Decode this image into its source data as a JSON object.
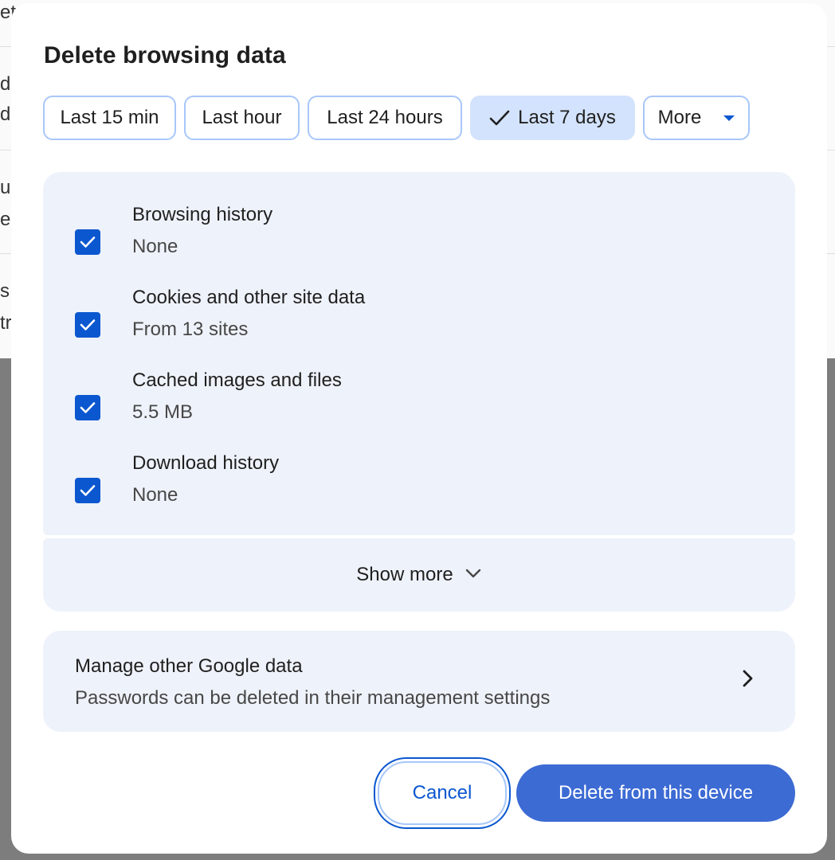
{
  "background": {
    "fragments": [
      "et",
      "d",
      "d",
      "u",
      "e",
      "s",
      "tr"
    ]
  },
  "dialog": {
    "title": "Delete browsing data",
    "time_ranges": [
      {
        "label": "Last 15 min",
        "selected": false
      },
      {
        "label": "Last hour",
        "selected": false
      },
      {
        "label": "Last 24 hours",
        "selected": false
      },
      {
        "label": "Last 7 days",
        "selected": true
      },
      {
        "label": "More",
        "selected": false,
        "dropdown": true
      }
    ],
    "items": [
      {
        "title": "Browsing history",
        "subtitle": "None",
        "checked": true
      },
      {
        "title": "Cookies and other site data",
        "subtitle": "From 13 sites",
        "checked": true
      },
      {
        "title": "Cached images and files",
        "subtitle": "5.5 MB",
        "checked": true
      },
      {
        "title": "Download history",
        "subtitle": "None",
        "checked": true
      }
    ],
    "show_more_label": "Show more",
    "google_data": {
      "title": "Manage other Google data",
      "subtitle": "Passwords can be deleted in their management settings"
    },
    "buttons": {
      "cancel": "Cancel",
      "delete": "Delete from this device"
    }
  },
  "colors": {
    "accent": "#0b57d0",
    "chip_selected_bg": "#d3e3fd",
    "panel_bg": "#eef2fa",
    "primary_button": "#3d6bd4"
  },
  "icons": {
    "selected_chip": "checkmark-icon",
    "more_dropdown": "caret-down-icon",
    "checkbox": "checkbox-checked-icon",
    "show_more": "chevron-down-icon",
    "google_data": "chevron-right-icon"
  }
}
